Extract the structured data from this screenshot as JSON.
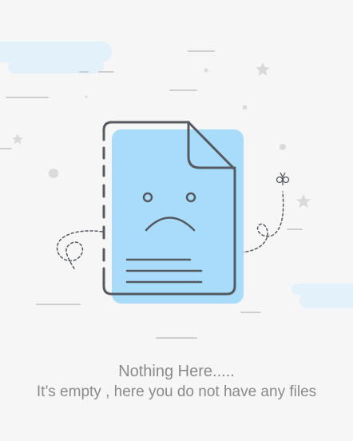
{
  "empty_state": {
    "title": "Nothing Here.....",
    "subtitle": "It’s empty , here you do not have any files",
    "illustration_icon": "sad-document-icon"
  },
  "colors": {
    "background": "#f6f6f6",
    "accent_fill": "#a9dcfb",
    "outline": "#555a60",
    "decor_line": "#cfcfcf",
    "decor_star": "#d9d9d9",
    "text": "#8a8a8a"
  }
}
